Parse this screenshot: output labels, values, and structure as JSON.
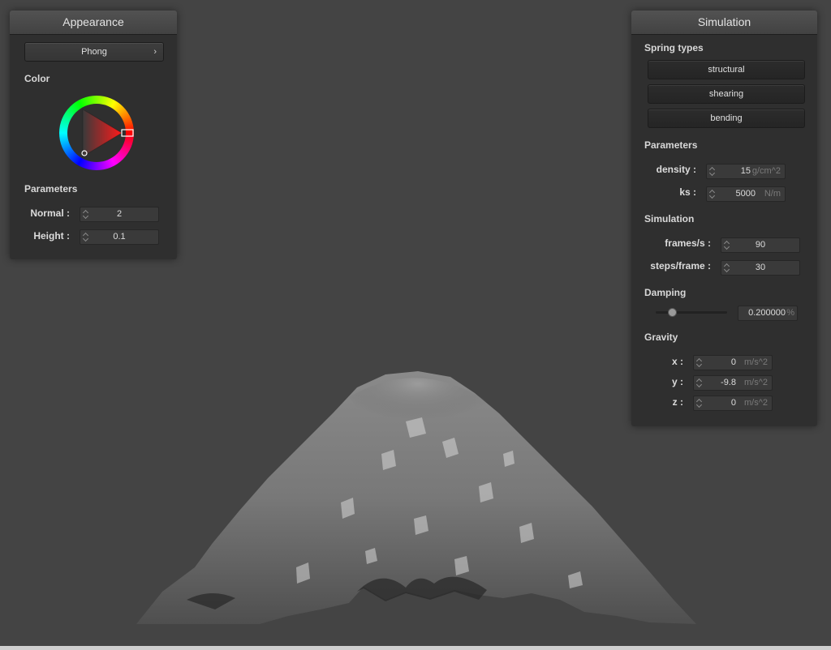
{
  "appearance": {
    "title": "Appearance",
    "shader_label": "Phong",
    "chevron": "›",
    "color_label": "Color",
    "parameters_label": "Parameters",
    "normal_label": "Normal :",
    "normal_value": "2",
    "height_label": "Height :",
    "height_value": "0.1",
    "icons": [
      "chevron-right-icon",
      "color-wheel-icon"
    ]
  },
  "simulation": {
    "title": "Simulation",
    "spring_types_label": "Spring types",
    "spring_buttons": [
      "structural",
      "shearing",
      "bending"
    ],
    "parameters_label": "Parameters",
    "density_label": "density :",
    "density_value": "15",
    "density_unit": "g/cm^2",
    "ks_label": "ks :",
    "ks_value": "5000",
    "ks_unit": "N/m",
    "simulation_label": "Simulation",
    "fps_label": "frames/s :",
    "fps_value": "90",
    "steps_label": "steps/frame :",
    "steps_value": "30",
    "damping_label": "Damping",
    "damping_fraction": 0.2,
    "damping_value": "0.200000",
    "damping_unit": "%",
    "gravity_label": "Gravity",
    "gravity": {
      "x_label": "x :",
      "x_value": "0",
      "y_label": "y :",
      "y_value": "-9.8",
      "z_label": "z :",
      "z_value": "0",
      "unit": "m/s^2"
    }
  },
  "colors": {
    "background": "#444444",
    "panel": "#2f2f2f",
    "cloth": "#9a9a9a",
    "selected_hue": "#ff2020"
  }
}
